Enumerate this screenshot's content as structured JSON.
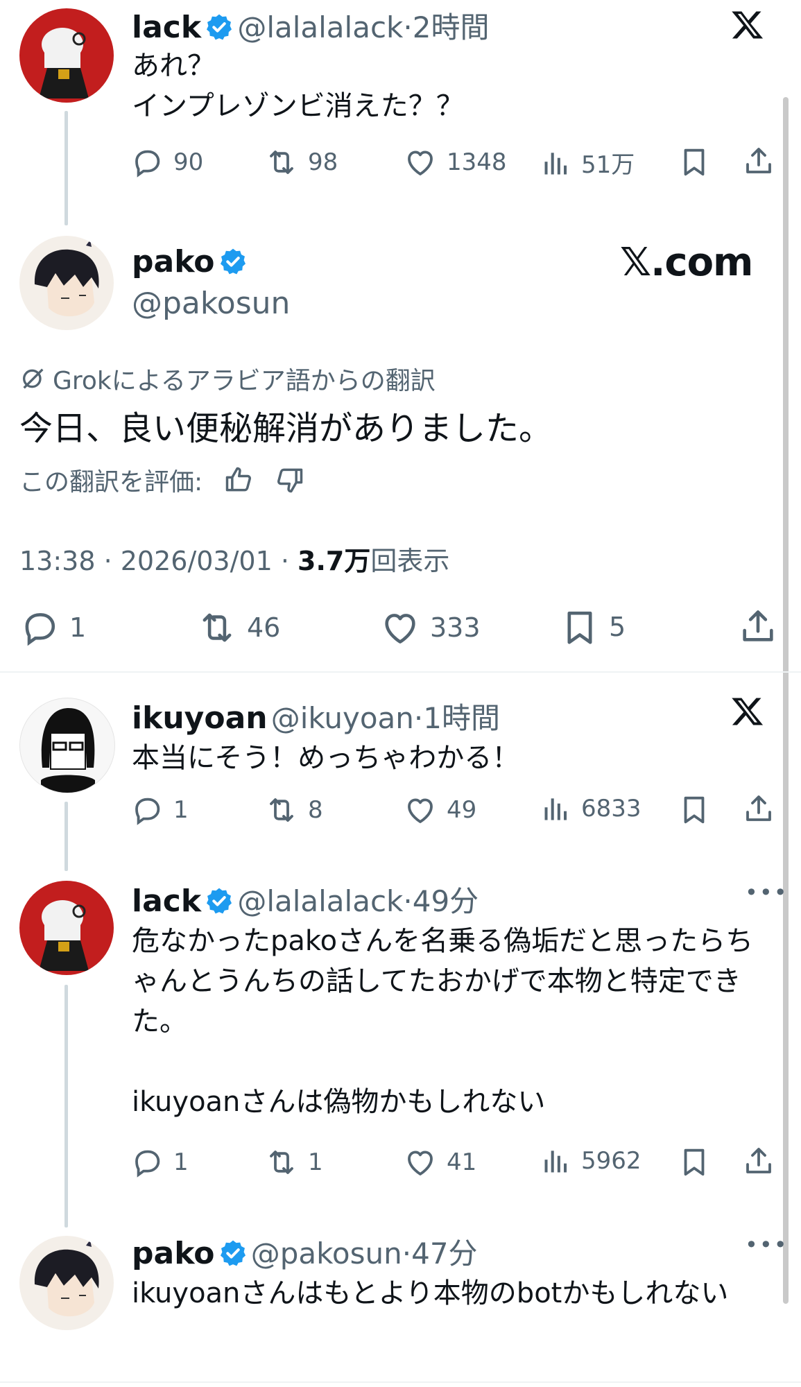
{
  "colors": {
    "text": "#0f1419",
    "muted": "#536471",
    "verified": "#1d9bf0",
    "line": "#cfd9de"
  },
  "posts": {
    "p1": {
      "name": "lack",
      "handle": "@lalalalack",
      "time": "2時間",
      "text": "あれ？\nインプレゾンビ消えた？？",
      "replies": "90",
      "reposts": "98",
      "likes": "1348",
      "views": "51万"
    },
    "main": {
      "name": "pako",
      "handle": "@pakosun",
      "watermark": "𝕏.com",
      "translation_label": "Grokによるアラビア語からの翻訳",
      "text": "今日、良い便秘解消がありました。",
      "rate_label": "この翻訳を評価:",
      "datetime": "13:38 · 2026/03/01 · ",
      "views_count": "3.7万",
      "views_label": "回表示",
      "replies": "1",
      "reposts": "46",
      "likes": "333",
      "bookmarks": "5"
    },
    "p2": {
      "name": "ikuyoan",
      "handle": "@ikuyoan",
      "time": "1時間",
      "text": "本当にそう！めっちゃわかる！",
      "replies": "1",
      "reposts": "8",
      "likes": "49",
      "views": "6833"
    },
    "p3": {
      "name": "lack",
      "handle": "@lalalalack",
      "time": "49分",
      "text": "危なかったpakoさんを名乗る偽垢だと思ったらちゃんとうんちの話してたおかげで本物と特定できた。\n\nikuyoanさんは偽物かもしれない",
      "replies": "1",
      "reposts": "1",
      "likes": "41",
      "views": "5962"
    },
    "p4": {
      "name": "pako",
      "handle": "@pakosun",
      "time": "47分",
      "text": "ikuyoanさんはもとより本物のbotかもしれない"
    }
  },
  "icons": [
    "reply-icon",
    "repost-icon",
    "like-icon",
    "views-icon",
    "bookmark-icon",
    "share-icon",
    "verified-icon",
    "x-logo-icon",
    "grok-icon",
    "thumbs-up-icon",
    "thumbs-down-icon",
    "more-icon"
  ]
}
